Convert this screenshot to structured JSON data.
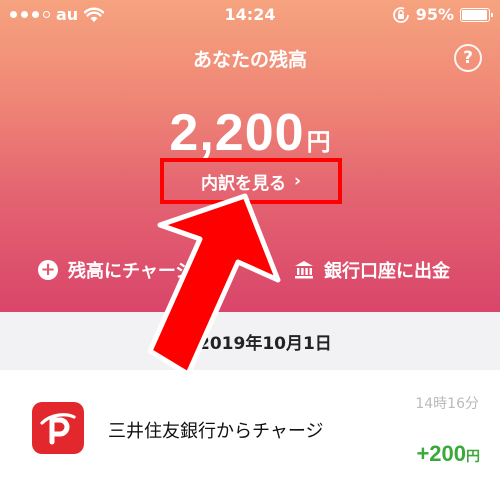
{
  "status_bar": {
    "carrier": "au",
    "time": "14:24",
    "battery": "95%",
    "battery_level": 0.95
  },
  "header": {
    "title": "あなたの残高",
    "help_label": "?"
  },
  "balance": {
    "amount": "2,200",
    "unit": "円",
    "detail_button": "内訳を見る",
    "detail_chevron": "›"
  },
  "actions": {
    "charge_label": "残高にチャージ",
    "bank_label": "銀行口座に出金"
  },
  "history": {
    "date": "2019年10月1日",
    "items": [
      {
        "name": "三井住友銀行からチャージ",
        "time": "14時16分",
        "amount": "+200",
        "unit": "円"
      }
    ]
  },
  "icons": {
    "signal": "signal-dots-icon",
    "wifi": "wifi-icon",
    "rotation_lock": "rotation-lock-icon",
    "battery": "battery-icon",
    "help": "help-icon",
    "charge": "plus-circle-icon",
    "bank": "bank-icon",
    "logo": "paypay-logo-icon",
    "annotation": "red-arrow-icon"
  },
  "colors": {
    "gradient_top": "#f6a37f",
    "gradient_bottom": "#d9456a",
    "highlight": "#ff0000",
    "positive": "#3aa83a",
    "logo_red": "#e3282d"
  }
}
